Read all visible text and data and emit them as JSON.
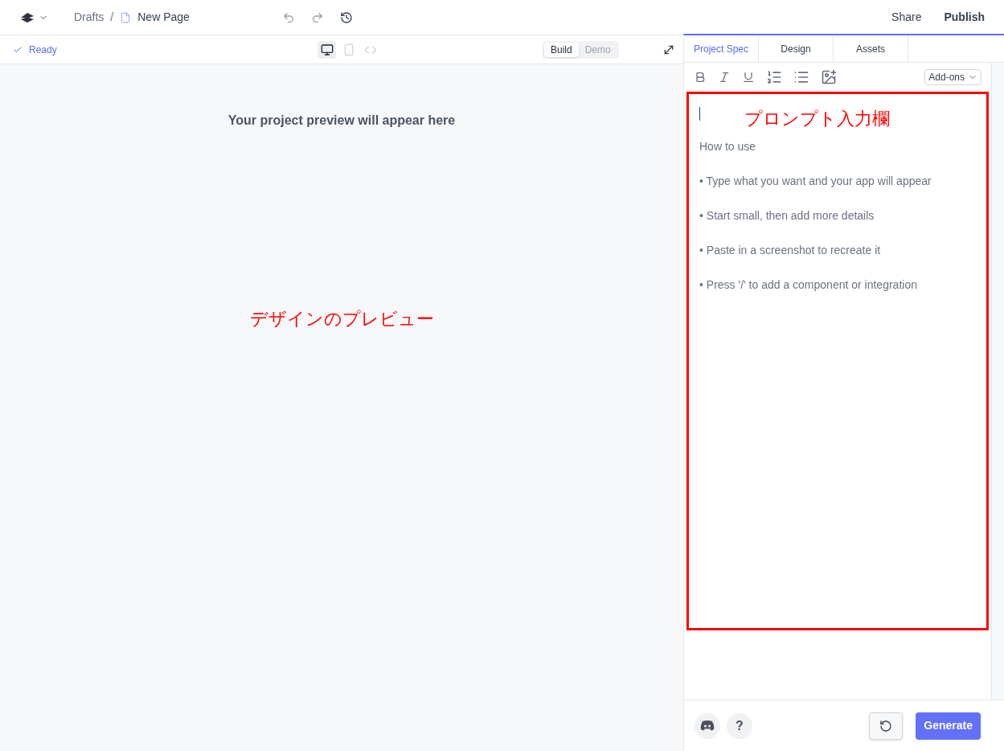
{
  "breadcrumb": {
    "parent": "Drafts",
    "separator": "/",
    "page": "New Page"
  },
  "header_actions": [
    "Share",
    "Publish"
  ],
  "status": {
    "label": "Ready"
  },
  "view_modes": [
    {
      "kind": "desktop",
      "selected": true
    },
    {
      "kind": "mobile",
      "selected": false
    },
    {
      "kind": "code",
      "selected": false
    }
  ],
  "mode_toggle": [
    {
      "label": "Build",
      "selected": true
    },
    {
      "label": "Demo",
      "selected": false
    }
  ],
  "preview": {
    "message": "Your project preview will appear here",
    "annotation": "デザインのプレビュー"
  },
  "tabs": [
    {
      "label": "Project Spec",
      "selected": true
    },
    {
      "label": "Design",
      "selected": false
    },
    {
      "label": "Assets",
      "selected": false
    }
  ],
  "toolbar": {
    "addons": "Add-ons"
  },
  "editor": {
    "annotation": "プロンプト入力欄",
    "heading": "How to use",
    "tips": [
      "• Type what you want and your app will appear",
      "• Start small, then add more details",
      "• Paste in a screenshot to recreate it",
      "• Press '/' to add a component or integration"
    ]
  },
  "footer": {
    "help": "?",
    "generate": "Generate"
  }
}
